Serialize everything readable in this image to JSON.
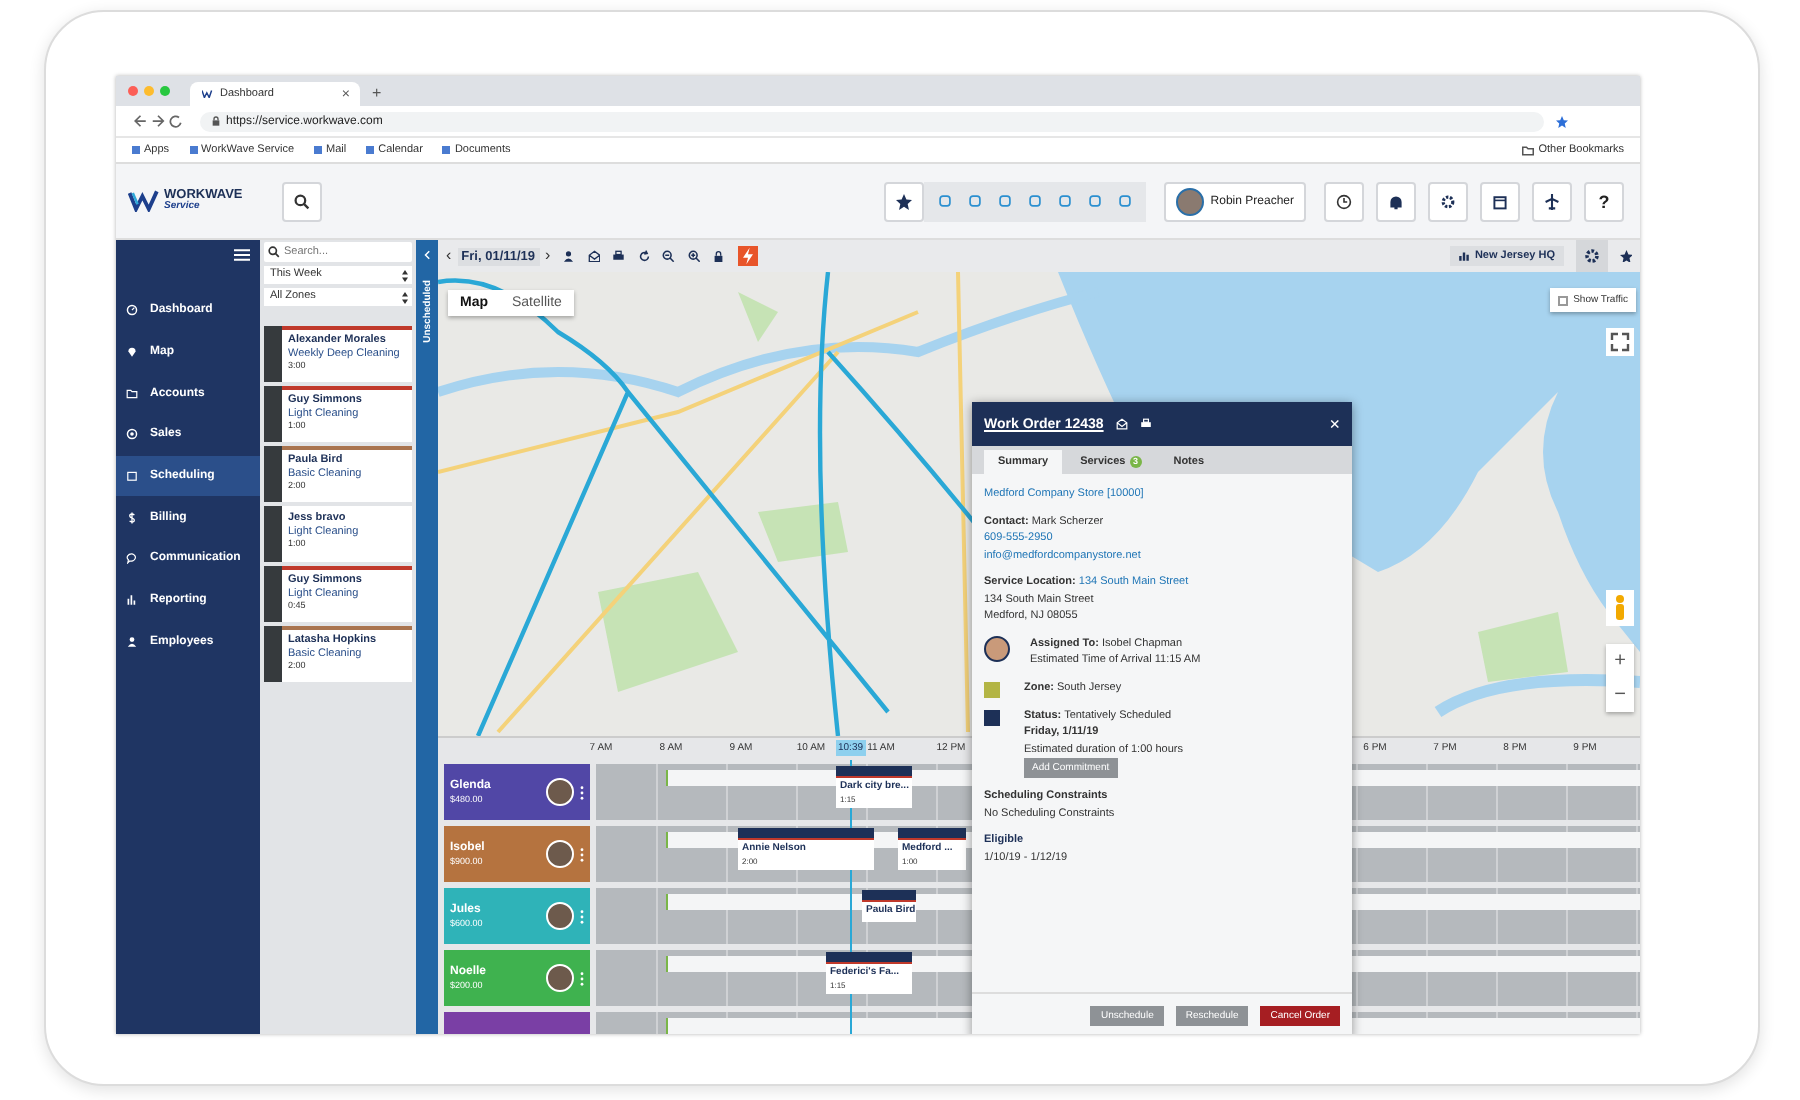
{
  "browser": {
    "tab": "Dashboard",
    "tab_close": "×",
    "new_tab": "+",
    "url": "https://service.workwave.com",
    "bookmarks": [
      "Apps",
      "WorkWave Service",
      "Mail",
      "Calendar",
      "Documents"
    ],
    "other_bookmarks": "Other Bookmarks"
  },
  "header": {
    "logo": "WORKWAVE",
    "logo_sub": "Service",
    "user": "Robin Preacher",
    "help": "?"
  },
  "nav": [
    {
      "label": "Dashboard",
      "kind": "gauge",
      "selected": false
    },
    {
      "label": "Map",
      "kind": "pin",
      "selected": false
    },
    {
      "label": "Accounts",
      "kind": "folder",
      "selected": false
    },
    {
      "label": "Sales",
      "kind": "target",
      "selected": false
    },
    {
      "label": "Scheduling",
      "kind": "calendar",
      "selected": true
    },
    {
      "label": "Billing",
      "kind": "dollar",
      "selected": false
    },
    {
      "label": "Communication",
      "kind": "bubble",
      "selected": false
    },
    {
      "label": "Reporting",
      "kind": "bars",
      "selected": false
    },
    {
      "label": "Employees",
      "kind": "person",
      "selected": false
    }
  ],
  "list": {
    "search_placeholder": "Search...",
    "filters": [
      "This Week",
      "All Zones"
    ],
    "cards": [
      {
        "name": "Alexander Morales",
        "service": "Weekly Deep Cleaning",
        "duration": "3:00",
        "color": "#c0392b"
      },
      {
        "name": "Guy Simmons",
        "service": "Light Cleaning",
        "duration": "1:00",
        "color": "#c0392b"
      },
      {
        "name": "Paula Bird",
        "service": "Basic Cleaning",
        "duration": "2:00",
        "color": "#a9744f"
      },
      {
        "name": "Jess bravo",
        "service": "Light Cleaning",
        "duration": "1:00"
      },
      {
        "name": "Guy Simmons",
        "service": "Light Cleaning",
        "duration": "0:45",
        "color": "#c0392b"
      },
      {
        "name": "Latasha Hopkins",
        "service": "Basic Cleaning",
        "duration": "2:00",
        "color": "#a9744f"
      }
    ]
  },
  "unscheduled_tab": "Unscheduled",
  "toolbar": {
    "prev": "‹",
    "date": "Fri, 01/11/19",
    "next": "›",
    "location": "New Jersey HQ"
  },
  "map": {
    "types": [
      {
        "label": "Map",
        "selected": true
      },
      {
        "label": "Satellite",
        "selected": false
      }
    ],
    "traffic": {
      "label": "Show Traffic",
      "checked": false
    },
    "zoom_in": "+",
    "zoom_out": "−"
  },
  "work_order": {
    "title": "Work Order 12438",
    "close": "×",
    "tabs": [
      {
        "label": "Summary",
        "selected": true
      },
      {
        "label": "Services",
        "badge": "3",
        "selected": false
      },
      {
        "label": "Notes",
        "selected": false
      }
    ],
    "account": "Medford Company Store [10000]",
    "contact": "**Contact:** Mark Scherzer",
    "phone": "609-555-2950",
    "email": "info@medfordcompanystore.net",
    "location_label": "Service Location:",
    "location_link": "134 South Main Street",
    "address": [
      "134 South Main Street",
      "Medford, NJ 08055"
    ],
    "assigned": "**Assigned To:** Isobel Chapman",
    "eta": "Estimated Time of Arrival 11:15 AM",
    "zone": "**Zone:** South Jersey",
    "status": "**Status:** Tentatively Scheduled",
    "date": "Friday, 1/11/19",
    "duration": "Estimated duration of 1:00 hours",
    "add_button": "Add Commitment",
    "constraints_title": "Scheduling Constraints",
    "constraints": "No Scheduling Constraints",
    "eligible_title": "Eligible",
    "eligible": "1/10/19 - 1/12/19",
    "buttons": [
      {
        "label": "Unschedule",
        "kind": "secondary"
      },
      {
        "label": "Reschedule",
        "kind": "secondary"
      },
      {
        "label": "Cancel Order",
        "kind": "danger"
      }
    ]
  },
  "timeline": {
    "hours_morning": [
      "7 AM",
      "8 AM",
      "9 AM",
      "10 AM",
      "11 AM",
      "12 PM"
    ],
    "now": "10:39",
    "hours_evening": [
      "6 PM",
      "7 PM",
      "8 PM",
      "9 PM"
    ],
    "resources": [
      {
        "name": "Glenda",
        "amount": "$480.00",
        "color": "#5147a6",
        "events": [
          {
            "title": "Dark city bre...",
            "duration": "1:15"
          }
        ]
      },
      {
        "name": "Isobel",
        "amount": "$900.00",
        "color": "#b5733f",
        "events": [
          {
            "title": "Annie Nelson",
            "duration": "2:00"
          },
          {
            "title": "Medford ...",
            "duration": "1:00"
          }
        ]
      },
      {
        "name": "Jules",
        "amount": "$600.00",
        "color": "#2fb3b8",
        "events": [
          {
            "title": "Paula Bird"
          }
        ]
      },
      {
        "name": "Noelle",
        "amount": "$200.00",
        "color": "#3fb24f",
        "events": [
          {
            "title": "Federici's Fa...",
            "duration": "1:15"
          }
        ]
      },
      {
        "color": "#7a3fa5"
      }
    ]
  }
}
